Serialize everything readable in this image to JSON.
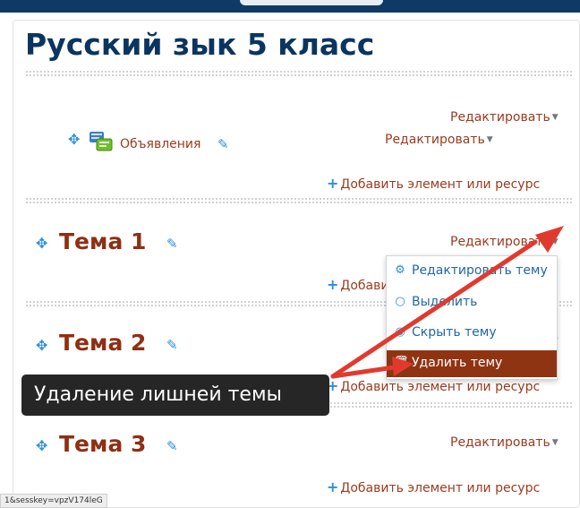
{
  "course": {
    "title": "Русский зык 5 класс"
  },
  "labels": {
    "edit": "Редактировать",
    "add_resource": "Добавить элемент или ресурс"
  },
  "section0": {
    "activity_name": "Объявления"
  },
  "topics": [
    {
      "name": "Тема 1"
    },
    {
      "name": "Тема 2"
    },
    {
      "name": "Тема 3"
    }
  ],
  "edit_menu": {
    "items": [
      {
        "label": "Редактировать тему",
        "icon": "gear-icon"
      },
      {
        "label": "Выделить",
        "icon": "circle-icon"
      },
      {
        "label": "Скрыть тему",
        "icon": "eye-icon"
      },
      {
        "label": "Удалить тему",
        "icon": "trash-icon",
        "highlighted": true
      }
    ]
  },
  "annotation": {
    "tooltip_text": "Удаление лишней темы",
    "arrow_color": "#e03a2f"
  },
  "status": {
    "url_fragment": "1&sesskey=vpzV174leG"
  },
  "colors": {
    "title": "#0b3560",
    "topic": "#8f2f13",
    "link": "#9a3b1f",
    "accent": "#2d8fd6",
    "highlight": "#8f3413"
  }
}
